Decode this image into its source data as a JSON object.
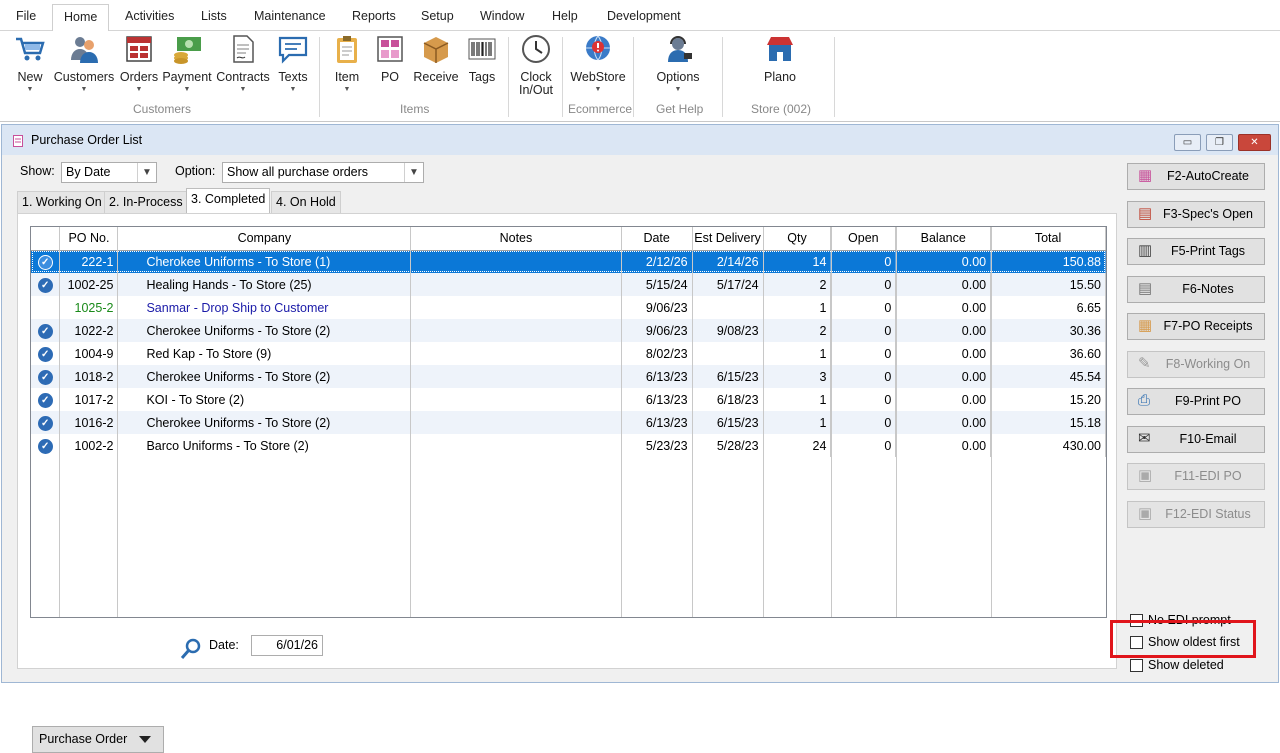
{
  "menu": [
    "File",
    "Home",
    "Activities",
    "Lists",
    "Maintenance",
    "Reports",
    "Setup",
    "Window",
    "Help",
    "Development"
  ],
  "ribbon": {
    "buttons": {
      "new": "New",
      "customers": "Customers",
      "orders": "Orders",
      "payment": "Payment",
      "contracts": "Contracts",
      "texts": "Texts",
      "item": "Item",
      "po": "PO",
      "receive": "Receive",
      "tags": "Tags",
      "clock1": "Clock",
      "clock2": "In/Out",
      "webstore": "WebStore",
      "options": "Options",
      "plano": "Plano"
    },
    "groups": {
      "customers": "Customers",
      "items": "Items",
      "ecommerce": "Ecommerce",
      "get_help": "Get Help",
      "store": "Store (002)"
    }
  },
  "window": {
    "title": "Purchase Order List",
    "show_label": "Show:",
    "show_value": "By Date",
    "option_label": "Option:",
    "option_value": "Show all purchase orders",
    "tabs": [
      "1. Working On",
      "2. In-Process",
      "3. Completed",
      "4. On Hold"
    ],
    "active_tab": 2
  },
  "grid": {
    "columns": [
      "",
      "PO No.",
      "Company",
      "Notes",
      "Date",
      "Est Delivery",
      "Qty",
      "Open",
      "Balance",
      "Total"
    ],
    "rows": [
      {
        "po": "222-1",
        "company": "Cherokee Uniforms - To Store (1)",
        "notes": "",
        "date": "2/12/26",
        "est": "2/14/26",
        "qty": "14",
        "open": "0",
        "balance": "0.00",
        "total": "150.88",
        "selected": true
      },
      {
        "po": "1002-25",
        "company": "Healing Hands - To Store (25)",
        "notes": "",
        "date": "5/15/24",
        "est": "5/17/24",
        "qty": "2",
        "open": "0",
        "balance": "0.00",
        "total": "15.50"
      },
      {
        "po": "1025-2",
        "company": "Sanmar - Drop Ship to Customer",
        "notes": "",
        "date": "9/06/23",
        "est": "",
        "qty": "1",
        "open": "0",
        "balance": "0.00",
        "total": "6.65",
        "colored": true,
        "nocheck": true
      },
      {
        "po": "1022-2",
        "company": "Cherokee Uniforms - To Store (2)",
        "notes": "",
        "date": "9/06/23",
        "est": "9/08/23",
        "qty": "2",
        "open": "0",
        "balance": "0.00",
        "total": "30.36"
      },
      {
        "po": "1004-9",
        "company": "Red Kap - To Store (9)",
        "notes": "",
        "date": "8/02/23",
        "est": "",
        "qty": "1",
        "open": "0",
        "balance": "0.00",
        "total": "36.60"
      },
      {
        "po": "1018-2",
        "company": "Cherokee Uniforms - To Store (2)",
        "notes": "",
        "date": "6/13/23",
        "est": "6/15/23",
        "qty": "3",
        "open": "0",
        "balance": "0.00",
        "total": "45.54"
      },
      {
        "po": "1017-2",
        "company": "KOI - To Store (2)",
        "notes": "",
        "date": "6/13/23",
        "est": "6/18/23",
        "qty": "1",
        "open": "0",
        "balance": "0.00",
        "total": "15.20"
      },
      {
        "po": "1016-2",
        "company": "Cherokee Uniforms - To Store (2)",
        "notes": "",
        "date": "6/13/23",
        "est": "6/15/23",
        "qty": "1",
        "open": "0",
        "balance": "0.00",
        "total": "15.18"
      },
      {
        "po": "1002-2",
        "company": "Barco Uniforms - To Store (2)",
        "notes": "",
        "date": "5/23/23",
        "est": "5/28/23",
        "qty": "24",
        "open": "0",
        "balance": "0.00",
        "total": "430.00"
      }
    ]
  },
  "fkeys": [
    {
      "label": "F2-AutoCreate",
      "enabled": true
    },
    {
      "label": "F3-Spec's Open",
      "enabled": true
    },
    {
      "label": "F5-Print Tags",
      "enabled": true
    },
    {
      "label": "F6-Notes",
      "enabled": true
    },
    {
      "label": "F7-PO Receipts",
      "enabled": true
    },
    {
      "label": "F8-Working On",
      "enabled": false
    },
    {
      "label": "F9-Print PO",
      "enabled": true
    },
    {
      "label": "F10-Email",
      "enabled": true
    },
    {
      "label": "F11-EDI PO",
      "enabled": false
    },
    {
      "label": "F12-EDI Status",
      "enabled": false
    }
  ],
  "bottom": {
    "po_button": "Purchase Order",
    "date_label": "Date:",
    "date_value": "6/01/26"
  },
  "checkboxes": {
    "no_edi": "No EDI prompt",
    "oldest": "Show oldest first",
    "deleted": "Show deleted"
  },
  "colors": {
    "selection": "#0b78d7",
    "accent_green": "#1a8a1a",
    "accent_blue": "#1a1aa8",
    "highlight": "#e0151b"
  }
}
